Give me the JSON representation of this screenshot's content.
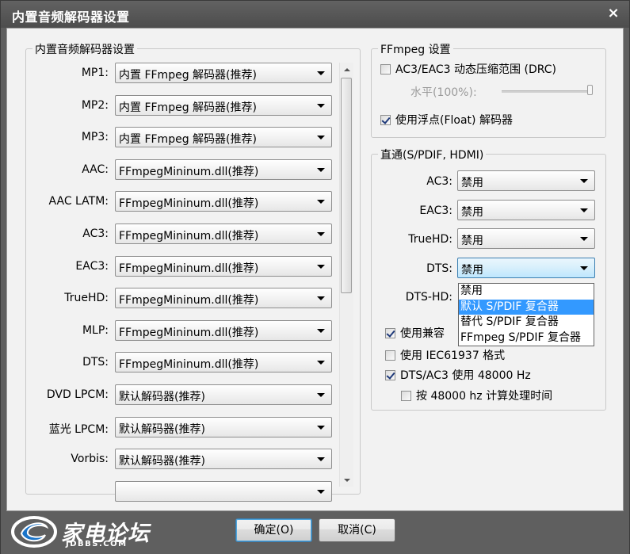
{
  "window": {
    "title": "内置音频解码器设置",
    "close_glyph": "×"
  },
  "left_group": {
    "title": "内置音频解码器设置",
    "rows": [
      {
        "label": "MP1:",
        "value": "内置 FFmpeg 解码器(推荐)"
      },
      {
        "label": "MP2:",
        "value": "内置 FFmpeg 解码器(推荐)"
      },
      {
        "label": "MP3:",
        "value": "内置 FFmpeg 解码器(推荐)"
      },
      {
        "label": "AAC:",
        "value": "FFmpegMininum.dll(推荐)"
      },
      {
        "label": "AAC LATM:",
        "value": "FFmpegMininum.dll(推荐)"
      },
      {
        "label": "AC3:",
        "value": "FFmpegMininum.dll(推荐)"
      },
      {
        "label": "EAC3:",
        "value": "FFmpegMininum.dll(推荐)"
      },
      {
        "label": "TrueHD:",
        "value": "FFmpegMininum.dll(推荐)"
      },
      {
        "label": "MLP:",
        "value": "FFmpegMininum.dll(推荐)"
      },
      {
        "label": "DTS:",
        "value": "FFmpegMininum.dll(推荐)"
      },
      {
        "label": "DVD LPCM:",
        "value": "默认解码器(推荐)"
      },
      {
        "label": "蓝光 LPCM:",
        "value": "默认解码器(推荐)"
      },
      {
        "label": "Vorbis:",
        "value": "默认解码器(推荐)"
      },
      {
        "label": "",
        "value": ""
      }
    ]
  },
  "ffmpeg_group": {
    "title": "FFmpeg 设置",
    "drc_label": "AC3/EAC3 动态压缩范围 (DRC)",
    "drc_checked": false,
    "level_label": "水平(100%):",
    "level_value": 1.0,
    "float_label": "使用浮点(Float) 解码器",
    "float_checked": true
  },
  "passthrough_group": {
    "title": "直通(S/PDIF, HDMI)",
    "rows": [
      {
        "label": "AC3:",
        "value": "禁用"
      },
      {
        "label": "EAC3:",
        "value": "禁用"
      },
      {
        "label": "TrueHD:",
        "value": "禁用"
      },
      {
        "label": "DTS:",
        "value": "禁用"
      },
      {
        "label": "DTS-HD:",
        "value": ""
      }
    ],
    "dropdown_options": [
      "禁用",
      "默认 S/PDIF 复合器",
      "替代 S/PDIF 复合器",
      "FFmpeg S/PDIF 复合器"
    ],
    "dropdown_selected_index": 1,
    "checks": [
      {
        "label": "使用兼容",
        "checked": true
      },
      {
        "label": "使用 IEC61937 格式",
        "checked": false
      },
      {
        "label": "DTS/AC3 使用 48000 Hz",
        "checked": true
      },
      {
        "label": "按 48000 hz 计算处理时间",
        "checked": false
      }
    ]
  },
  "buttons": {
    "ok": "确定(O)",
    "cancel": "取消(C)"
  },
  "logo": {
    "cn": "家电论坛",
    "en": "JDBBS.COM"
  },
  "colors": {
    "selection": "#3399ff",
    "titlebar": "#5a5a5a",
    "client": "#f2f2f2"
  }
}
